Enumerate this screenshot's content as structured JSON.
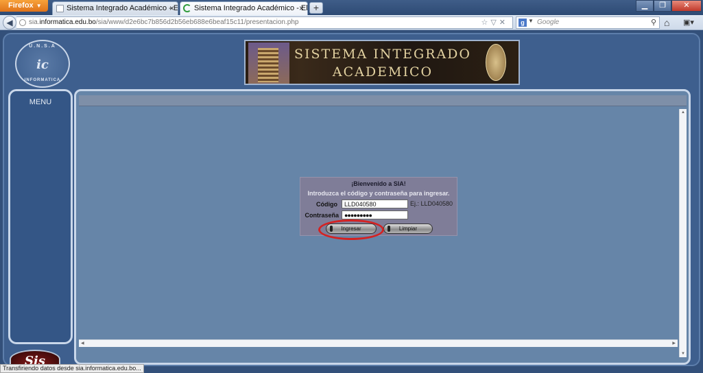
{
  "browser": {
    "firefox_button": "Firefox",
    "tabs": [
      {
        "title": "Sistema Integrado Académico - Elite ..."
      },
      {
        "title": "Sistema Integrado Académico - Elite ..."
      }
    ],
    "url_prefix": "sia.",
    "url_domain": "informatica.edu.bo",
    "url_path": "/sia/www/d2e6bc7b856d2b56eb688e6beaf15c11/presentacion.php",
    "search_placeholder": "Google",
    "status": "Transfiriendo datos desde sia.informatica.edu.bo..."
  },
  "header": {
    "logo_ring_top": "U.N.S.A",
    "logo_monogram": "ic",
    "logo_ring_bottom": "INFORMATICA",
    "banner_title": "SISTEMA INTEGRADO ACADEMICO"
  },
  "sidebar": {
    "menu_label": "MENU",
    "sis_logo": "Sis"
  },
  "login": {
    "welcome": "¡Bienvenido a SIA!",
    "intro": "Introduzca el código y contraseña para ingresar.",
    "code_label": "Código",
    "code_value": "LLD040580",
    "code_hint": "Ej.: LLD040580",
    "password_label": "Contraseña",
    "password_value": "●●●●●●●●●",
    "submit_label": "Ingresar",
    "clear_label": "Limpiar"
  },
  "colors": {
    "page_background": "#3e5f8e",
    "content_background": "#6685a8",
    "login_panel": "#7f7d98",
    "highlight_ring": "#d42222"
  }
}
